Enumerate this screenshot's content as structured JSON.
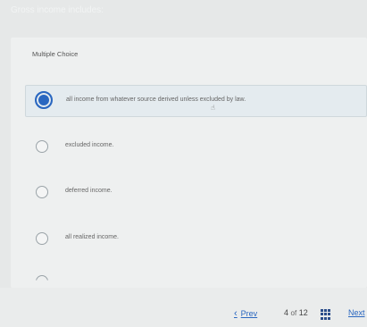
{
  "question": {
    "text": "Gross income includes:"
  },
  "section": {
    "type_label": "Multiple Choice"
  },
  "options": [
    {
      "text": "all income from whatever source derived unless excluded by law.",
      "selected": true
    },
    {
      "text": "excluded income.",
      "selected": false
    },
    {
      "text": "deferred income.",
      "selected": false
    },
    {
      "text": "all realized income.",
      "selected": false
    }
  ],
  "footer": {
    "prev_label": "Prev",
    "current_page": "4",
    "of_label": "of",
    "total_pages": "12",
    "next_label": "Next"
  },
  "colors": {
    "accent": "#2a67c0"
  }
}
